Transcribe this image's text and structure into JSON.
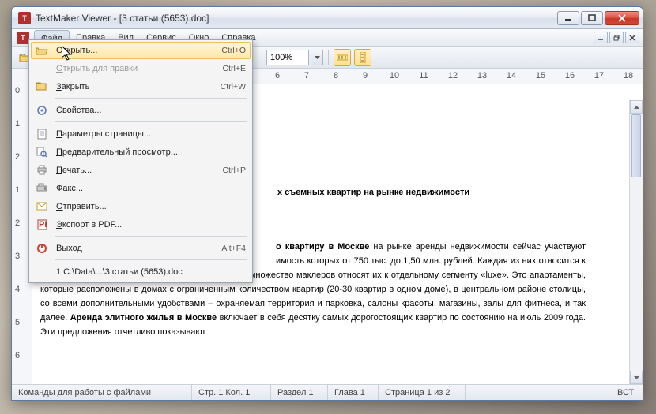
{
  "window": {
    "title": "TextMaker Viewer - [3 статьи (5653).doc]"
  },
  "menubar": {
    "items": [
      "Файл",
      "Правка",
      "Вид",
      "Сервис",
      "Окно",
      "Справка"
    ]
  },
  "toolbar": {
    "zoom": "100%"
  },
  "dropdown": {
    "items": [
      {
        "label": "Открыть...",
        "shortcut": "Ctrl+O",
        "icon": "folder-open"
      },
      {
        "label": "Открыть для правки",
        "shortcut": "Ctrl+E",
        "disabled": true
      },
      {
        "label": "Закрыть",
        "shortcut": "Ctrl+W",
        "icon": "folder-close"
      },
      {
        "sep": true
      },
      {
        "label": "Свойства...",
        "icon": "properties"
      },
      {
        "sep": true
      },
      {
        "label": "Параметры страницы...",
        "icon": "page-setup"
      },
      {
        "label": "Предварительный просмотр...",
        "icon": "preview"
      },
      {
        "label": "Печать...",
        "shortcut": "Ctrl+P",
        "icon": "print"
      },
      {
        "label": "Факс...",
        "icon": "fax"
      },
      {
        "label": "Отправить...",
        "icon": "send"
      },
      {
        "label": "Экспорт в PDF...",
        "icon": "pdf"
      },
      {
        "sep": true
      },
      {
        "label": "Выход",
        "shortcut": "Alt+F4",
        "icon": "exit"
      },
      {
        "sep": true
      },
      {
        "label": "1 C:\\Data\\...\\3 статьи (5653).doc",
        "recent": true
      }
    ]
  },
  "document": {
    "title_visible": "х съемных квартир на рынке недвижимости",
    "para_prefix_visible": "о квартиру в Москве",
    "para_rest": " на рынке аренды недвижимости сейчас участвуют ",
    "para_hidden_line": "имость которых от 750 тыс. до 1,50 млн. рублей. Каждая из них относится к самым престижным квартирам класса «премиум», множество маклеров относят их к отдельному сегменту «luxe». Это апартаменты, которые расположены в домах с ограниченным количеством квартир (20-30 квартир в одном доме), в центральном районе столицы, со всеми дополнительными удобствами – охраняемая территория и парковка, салоны красоты, магазины, залы для фитнеса, и так далее. ",
    "para_bold2": "Аренда элитного жилья в Москве",
    "para_tail": " включает в себя десятку самых дорогостоящих квартир по состоянию на июль 2009 года. Эти предложения отчетливо показывают"
  },
  "ruler_h": [
    "6",
    "7",
    "8",
    "9",
    "10",
    "11",
    "12",
    "13",
    "14",
    "15",
    "16",
    "17",
    "18"
  ],
  "ruler_v": [
    "0",
    "1",
    "2",
    "1",
    "2",
    "3",
    "4",
    "5",
    "6"
  ],
  "status": {
    "hint": "Команды для работы с файлами",
    "pos": "Стр. 1 Кол. 1",
    "section": "Раздел 1",
    "chapter": "Глава 1",
    "page": "Страница 1 из 2",
    "ins": "ВСТ"
  }
}
